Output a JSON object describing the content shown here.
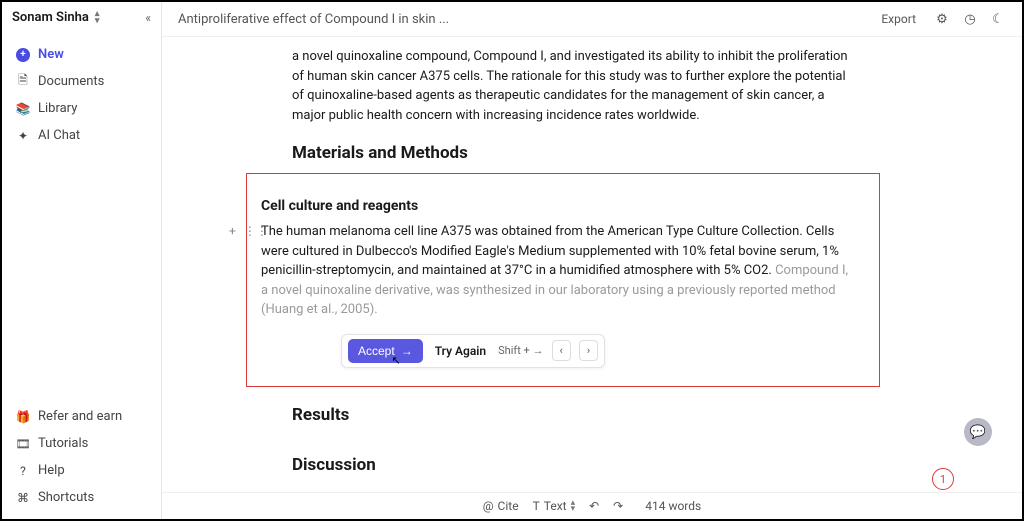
{
  "user": {
    "name": "Sonam Sinha"
  },
  "sidebar": {
    "new_label": "New",
    "items": [
      {
        "icon": "document-icon",
        "label": "Documents"
      },
      {
        "icon": "library-icon",
        "label": "Library"
      },
      {
        "icon": "chat-icon",
        "label": "AI Chat"
      }
    ],
    "footer": [
      {
        "icon": "gift-icon",
        "label": "Refer and earn"
      },
      {
        "icon": "video-icon",
        "label": "Tutorials"
      },
      {
        "icon": "help-icon",
        "label": "Help"
      },
      {
        "icon": "keyboard-icon",
        "label": "Shortcuts"
      }
    ]
  },
  "topbar": {
    "title": "Antiproliferative effect of Compound I in skin ...",
    "export": "Export"
  },
  "doc": {
    "intro_para": "a novel quinoxaline compound, Compound I, and investigated its ability to inhibit the proliferation of human skin cancer A375 cells. The rationale for this study was to further explore the potential of quinoxaline-based agents as therapeutic candidates for the management of skin cancer, a major public health concern with increasing incidence rates worldwide.",
    "h_methods": "Materials and Methods",
    "h_cellculture": "Cell culture and reagents",
    "cc_accepted": "The human melanoma cell line A375 was obtained from the American Type Culture Collection. Cells were cultured in Dulbecco's Modified Eagle's Medium supplemented with 10% fetal bovine serum, 1% penicillin-streptomycin, and maintained at 37°C in a humidified atmosphere with 5% CO2. ",
    "cc_suggestion": "Compound I, a novel quinoxaline derivative, was synthesized in our laboratory using a previously reported method (Huang et al., 2005).",
    "h_results": "Results",
    "h_discussion": "Discussion"
  },
  "actions": {
    "accept": "Accept",
    "try_again": "Try Again",
    "shortcut": "Shift + →"
  },
  "bottombar": {
    "cite": "Cite",
    "text": "Text",
    "wordcount": "414 words"
  },
  "badge": {
    "count": "1"
  }
}
